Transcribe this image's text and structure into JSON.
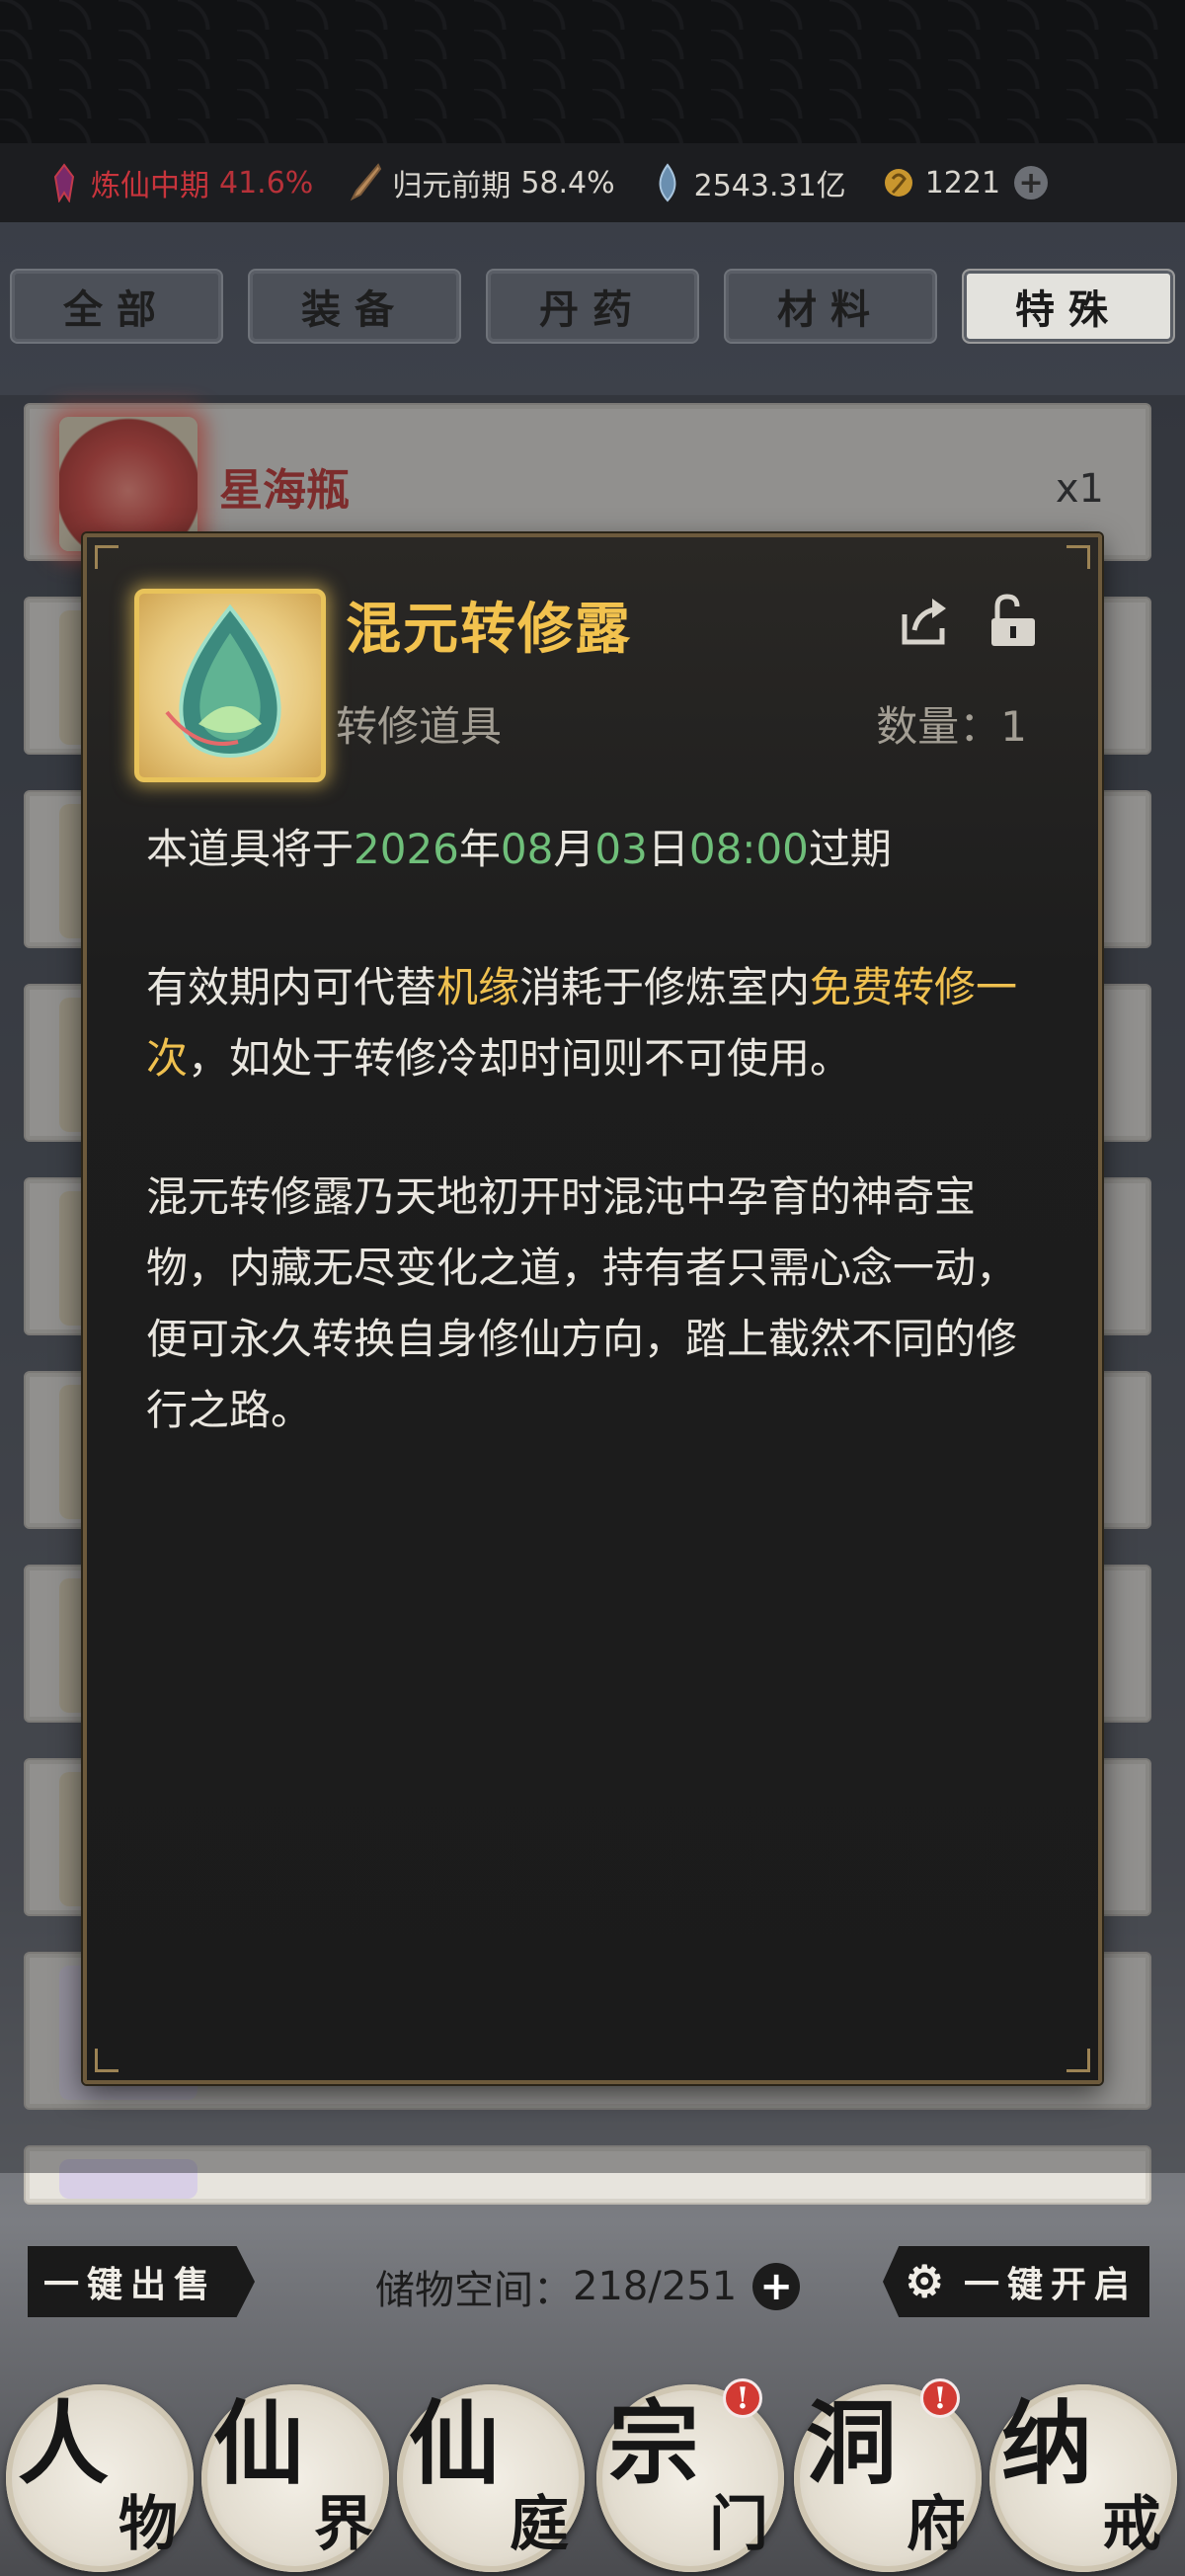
{
  "status": {
    "realm_main": "炼仙中期",
    "realm_main_pct": "41.6%",
    "realm_sub": "归元前期",
    "realm_sub_pct": "58.4%",
    "spirit_stone": "2543.31亿",
    "gold": "1221"
  },
  "tabs": [
    "全部",
    "装备",
    "丹药",
    "材料",
    "特殊"
  ],
  "active_tab": "特殊",
  "list": {
    "first_item": {
      "name": "星海瓶",
      "count": "x1"
    }
  },
  "modal": {
    "title": "混元转修露",
    "type": "转修道具",
    "quantity_label": "数量：",
    "quantity_value": "1",
    "expiry": {
      "prefix": "本道具将于",
      "year": "2026",
      "year_unit": "年",
      "month": "08",
      "month_unit": "月",
      "day": "03",
      "day_unit": "日",
      "time": "08:00",
      "suffix": "过期"
    },
    "effect": {
      "part1": "有效期内可代替",
      "highlight1": "机缘",
      "part2": "消耗于修炼室内",
      "highlight2": "免费转修一次",
      "part3": "，如处于转修冷却时间则不可使用。"
    },
    "lore": "混元转修露乃天地初开时混沌中孕育的神奇宝物，内藏无尽变化之道，持有者只需心念一动，便可永久转换自身修仙方向，踏上截然不同的修行之路。"
  },
  "bottom": {
    "sell_all": "一键出售",
    "storage_label": "储物空间：",
    "storage_value": "218/251",
    "open_all": "一键开启"
  },
  "nav": [
    {
      "big": "人",
      "small": "物",
      "badge": ""
    },
    {
      "big": "仙",
      "small": "界",
      "badge": ""
    },
    {
      "big": "仙",
      "small": "庭",
      "badge": ""
    },
    {
      "big": "宗",
      "small": "门",
      "badge": "!"
    },
    {
      "big": "洞",
      "small": "府",
      "badge": "!"
    },
    {
      "big": "纳",
      "small": "戒",
      "badge": ""
    }
  ],
  "colors": {
    "accent_gold": "#efc04f",
    "date_green": "#6fbf7a",
    "realm_red": "#c8343c"
  }
}
